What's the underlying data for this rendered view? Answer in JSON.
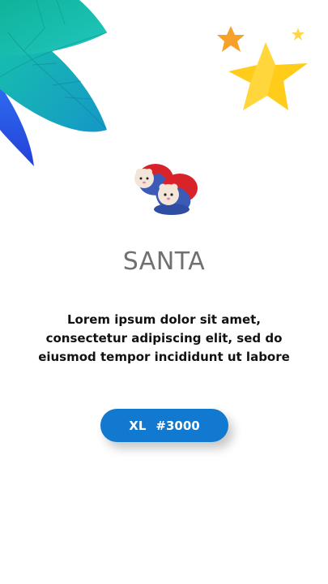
{
  "product": {
    "title": "SANTA",
    "description": "Lorem ipsum dolor sit amet, consectetur adipiscing elit, sed do eiusmod tempor incididunt ut labore",
    "size": "XL",
    "price": "#3000",
    "image": "baby-shoes-icon"
  },
  "decorations": {
    "leaves": "leaves-icon",
    "stars": "stars-icon"
  },
  "colors": {
    "button": "#1279d1",
    "title": "#707070",
    "star": "#ffcc1a",
    "star_orange": "#f6a12a",
    "leaf_teal": "#15b9a8",
    "leaf_blue": "#2c58e8"
  }
}
